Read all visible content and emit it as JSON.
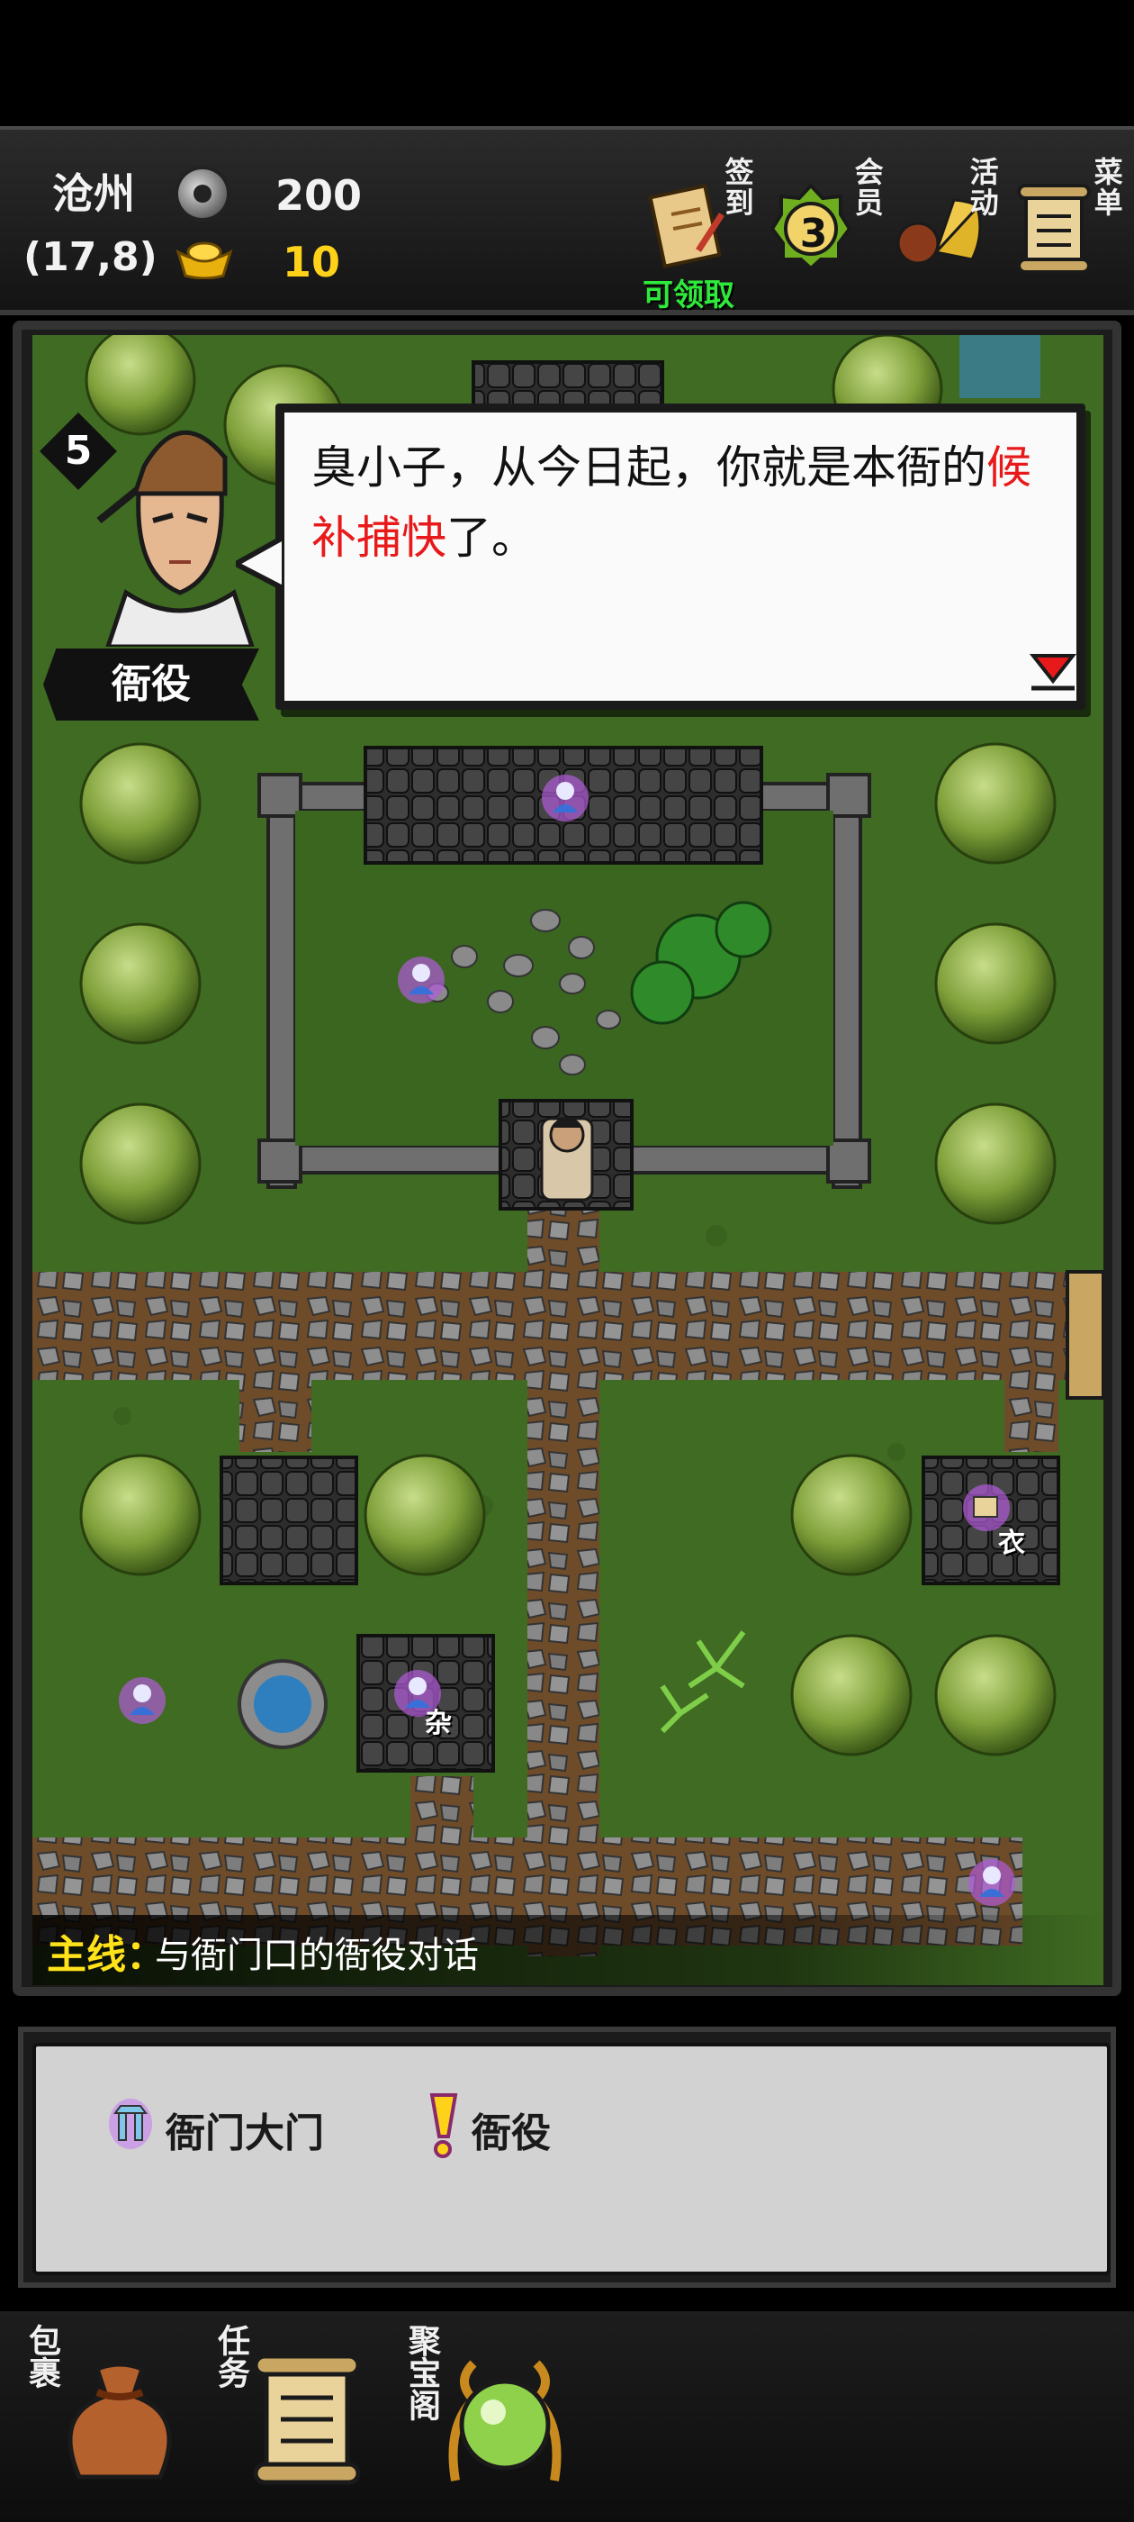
{
  "hud": {
    "location": "沧州",
    "coords": "(17,8)",
    "silver": "200",
    "gold": "10",
    "buttons": [
      {
        "label": "签到",
        "badge": "可领取",
        "icon": "scroll-sign-in-icon"
      },
      {
        "label": "会员",
        "badge": "3",
        "icon": "vip-medal-icon"
      },
      {
        "label": "活动",
        "icon": "event-fan-icon"
      },
      {
        "label": "菜单",
        "icon": "menu-scroll-icon"
      }
    ]
  },
  "dialog": {
    "level": "5",
    "speaker": "衙役",
    "text_normal_1": "臭小子，从今日起，你就是本衙的",
    "text_red": "候补捕快",
    "text_normal_2": "了。"
  },
  "map": {
    "shop_labels": {
      "clothes": "衣",
      "misc": "杂"
    }
  },
  "quest": {
    "label": "主线：",
    "text": "与衙门口的衙役对话"
  },
  "info": {
    "items": [
      {
        "icon": "gate-icon",
        "label": "衙门大门"
      },
      {
        "icon": "exclamation-icon",
        "label": "衙役"
      }
    ]
  },
  "bottom": {
    "buttons": [
      {
        "label": "包裹",
        "icon": "bag-icon"
      },
      {
        "label": "任务",
        "icon": "quest-scroll-icon"
      },
      {
        "label": "聚宝阁",
        "icon": "treasure-orb-icon"
      }
    ]
  },
  "colors": {
    "accent_gold": "#ffd21a",
    "claim_green": "#2eea3a",
    "red_text": "#e8191a",
    "grass": "#3f6b22"
  }
}
